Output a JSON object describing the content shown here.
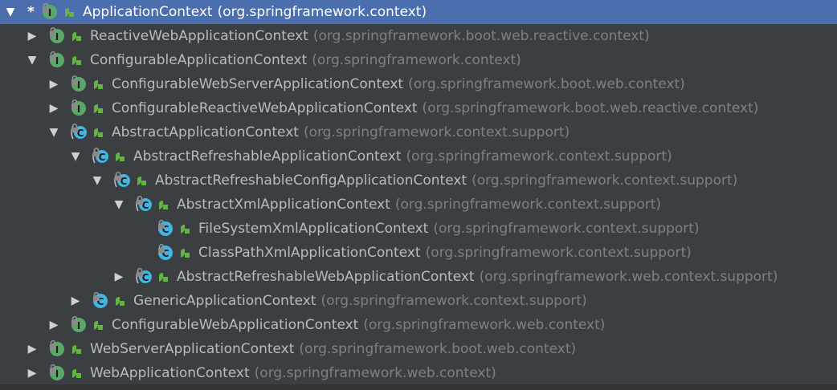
{
  "colors": {
    "background": "#3c3f41",
    "selection": "#4b6eaf",
    "interface_icon": "#59a869",
    "class_icon": "#40b6e0",
    "leaf": "#62b543",
    "package_text": "#808080",
    "name_text": "#bbbbbb"
  },
  "tree": [
    {
      "level": 0,
      "arrow": "expanded",
      "star": "*",
      "icon": "interface-icon",
      "name": "ApplicationContext",
      "package": "(org.springframework.context)",
      "selected": true
    },
    {
      "level": 1,
      "arrow": "collapsed",
      "icon": "interface-icon",
      "name": "ReactiveWebApplicationContext",
      "package": "(org.springframework.boot.web.reactive.context)"
    },
    {
      "level": 1,
      "arrow": "expanded",
      "icon": "interface-icon",
      "name": "ConfigurableApplicationContext",
      "package": "(org.springframework.context)"
    },
    {
      "level": 2,
      "arrow": "collapsed",
      "icon": "interface-icon",
      "name": "ConfigurableWebServerApplicationContext",
      "package": "(org.springframework.boot.web.context)"
    },
    {
      "level": 2,
      "arrow": "collapsed",
      "icon": "interface-icon",
      "name": "ConfigurableReactiveWebApplicationContext",
      "package": "(org.springframework.boot.web.reactive.context)"
    },
    {
      "level": 2,
      "arrow": "expanded",
      "icon": "abstract-class-icon",
      "name": "AbstractApplicationContext",
      "package": "(org.springframework.context.support)"
    },
    {
      "level": 3,
      "arrow": "expanded",
      "icon": "abstract-class-icon",
      "name": "AbstractRefreshableApplicationContext",
      "package": "(org.springframework.context.support)"
    },
    {
      "level": 4,
      "arrow": "expanded",
      "icon": "abstract-class-icon",
      "name": "AbstractRefreshableConfigApplicationContext",
      "package": "(org.springframework.context.support)"
    },
    {
      "level": 5,
      "arrow": "expanded",
      "icon": "abstract-class-icon",
      "name": "AbstractXmlApplicationContext",
      "package": "(org.springframework.context.support)"
    },
    {
      "level": 6,
      "arrow": "none",
      "icon": "class-icon",
      "name": "FileSystemXmlApplicationContext",
      "package": "(org.springframework.context.support)"
    },
    {
      "level": 6,
      "arrow": "none",
      "icon": "class-icon",
      "name": "ClassPathXmlApplicationContext",
      "package": "(org.springframework.context.support)"
    },
    {
      "level": 5,
      "arrow": "collapsed",
      "icon": "abstract-class-icon",
      "name": "AbstractRefreshableWebApplicationContext",
      "package": "(org.springframework.web.context.support)"
    },
    {
      "level": 3,
      "arrow": "collapsed",
      "icon": "class-icon",
      "name": "GenericApplicationContext",
      "package": "(org.springframework.context.support)"
    },
    {
      "level": 2,
      "arrow": "collapsed",
      "icon": "interface-icon",
      "name": "ConfigurableWebApplicationContext",
      "package": "(org.springframework.web.context)"
    },
    {
      "level": 1,
      "arrow": "collapsed",
      "icon": "interface-icon",
      "name": "WebServerApplicationContext",
      "package": "(org.springframework.boot.web.context)"
    },
    {
      "level": 1,
      "arrow": "collapsed",
      "icon": "interface-icon",
      "name": "WebApplicationContext",
      "package": "(org.springframework.web.context)"
    }
  ]
}
